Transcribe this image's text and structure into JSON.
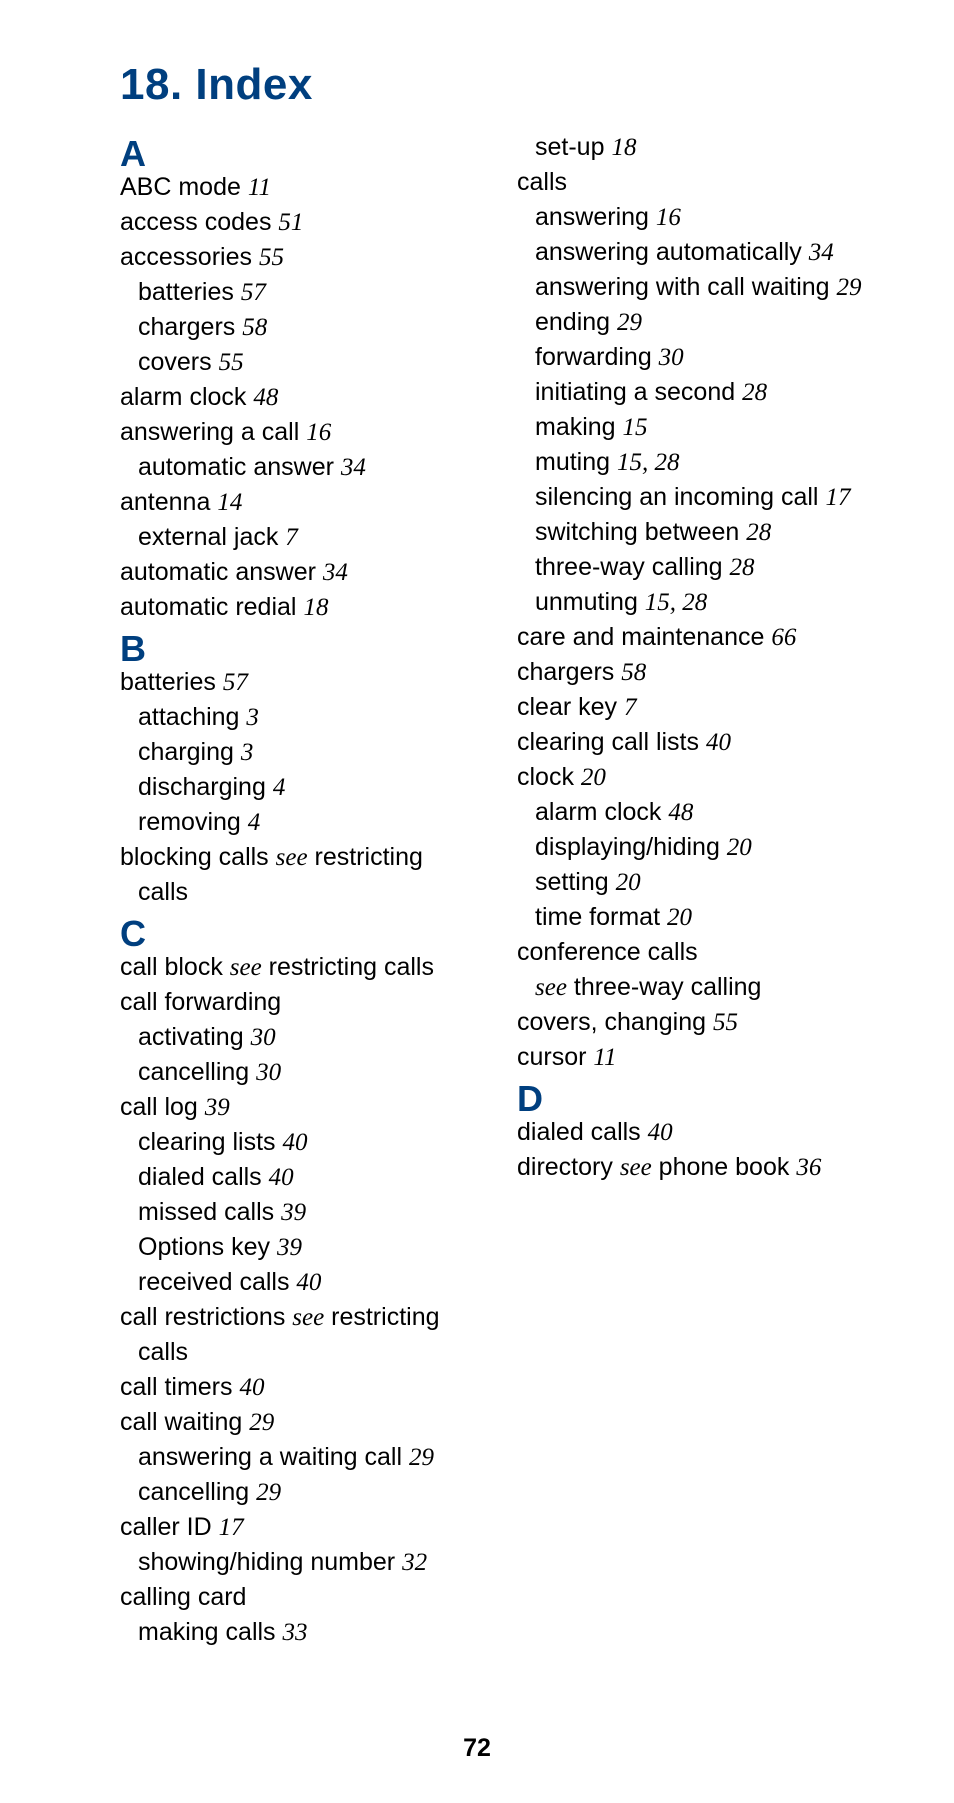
{
  "title": "18. Index",
  "pageNumber": "72",
  "sections": [
    {
      "letter": "A",
      "items": [
        {
          "text": "ABC mode",
          "page": "11"
        },
        {
          "text": "access codes",
          "page": "51"
        },
        {
          "text": "accessories",
          "page": "55"
        },
        {
          "text": "batteries",
          "page": "57",
          "sub": true
        },
        {
          "text": "chargers",
          "page": "58",
          "sub": true
        },
        {
          "text": "covers",
          "page": "55",
          "sub": true
        },
        {
          "text": "alarm clock",
          "page": "48"
        },
        {
          "text": "answering a call",
          "page": "16"
        },
        {
          "text": "automatic answer",
          "page": "34",
          "sub": true
        },
        {
          "text": "antenna",
          "page": "14"
        },
        {
          "text": "external jack",
          "page": "7",
          "sub": true
        },
        {
          "text": "automatic answer",
          "page": "34"
        },
        {
          "text": "automatic redial",
          "page": "18"
        }
      ]
    },
    {
      "letter": "B",
      "items": [
        {
          "text": "batteries",
          "page": "57"
        },
        {
          "text": "attaching",
          "page": "3",
          "sub": true
        },
        {
          "text": "charging",
          "page": "3",
          "sub": true
        },
        {
          "text": "discharging",
          "page": "4",
          "sub": true
        },
        {
          "text": "removing",
          "page": "4",
          "sub": true
        },
        {
          "text": "blocking calls ",
          "see": "see",
          "after": " restricting calls"
        }
      ]
    },
    {
      "letter": "C",
      "items": [
        {
          "text": "call block ",
          "see": "see",
          "after": " restricting calls"
        },
        {
          "text": "call forwarding"
        },
        {
          "text": "activating",
          "page": "30",
          "sub": true
        },
        {
          "text": "cancelling",
          "page": "30",
          "sub": true
        },
        {
          "text": "call log",
          "page": "39"
        },
        {
          "text": "clearing lists",
          "page": "40",
          "sub": true
        },
        {
          "text": "dialed calls",
          "page": "40",
          "sub": true
        },
        {
          "text": "missed calls",
          "page": "39",
          "sub": true
        },
        {
          "text": "Options key",
          "page": "39",
          "sub": true
        },
        {
          "text": "received calls",
          "page": "40",
          "sub": true
        },
        {
          "text": "call restrictions ",
          "see": "see",
          "after": " restricting calls"
        },
        {
          "text": "call timers",
          "page": "40"
        },
        {
          "text": "call waiting",
          "page": "29"
        },
        {
          "text": "answering a waiting call",
          "page": "29",
          "sub": true
        },
        {
          "text": "cancelling",
          "page": "29",
          "sub": true
        },
        {
          "text": "caller ID",
          "page": "17"
        },
        {
          "text": "showing/hiding number",
          "page": "32",
          "sub": true
        },
        {
          "text": "calling card"
        },
        {
          "text": "making calls",
          "page": "33",
          "sub": true
        },
        {
          "text": "set-up",
          "page": "18",
          "sub": true
        },
        {
          "text": "calls"
        },
        {
          "text": "answering",
          "page": "16",
          "sub": true
        },
        {
          "text": "answering automatically",
          "page": "34",
          "sub": true,
          "break": true
        },
        {
          "text": "answering with call waiting",
          "page": "29",
          "sub": true
        },
        {
          "text": "ending",
          "page": "29",
          "sub": true
        },
        {
          "text": "forwarding",
          "page": "30",
          "sub": true
        },
        {
          "text": "initiating a second",
          "page": "28",
          "sub": true
        },
        {
          "text": "making",
          "page": "15",
          "sub": true
        },
        {
          "text": "muting",
          "page": "15, 28",
          "sub": true
        },
        {
          "text": "silencing an incoming call",
          "page": "17",
          "sub": true
        },
        {
          "text": "switching between",
          "page": "28",
          "sub": true
        },
        {
          "text": "three-way calling",
          "page": "28",
          "sub": true
        },
        {
          "text": "unmuting",
          "page": "15, 28",
          "sub": true
        },
        {
          "text": "care and maintenance",
          "page": "66"
        },
        {
          "text": "chargers",
          "page": "58"
        },
        {
          "text": "clear key",
          "page": "7"
        },
        {
          "text": "clearing call lists",
          "page": "40"
        },
        {
          "text": "clock",
          "page": "20"
        },
        {
          "text": "alarm clock",
          "page": "48",
          "sub": true
        },
        {
          "text": "displaying/hiding",
          "page": "20",
          "sub": true
        },
        {
          "text": "setting",
          "page": "20",
          "sub": true
        },
        {
          "text": "time format",
          "page": "20",
          "sub": true
        },
        {
          "text": "conference calls"
        },
        {
          "see": "see",
          "after": " three-way calling",
          "sub": true,
          "text": ""
        },
        {
          "text": "covers, changing",
          "page": "55"
        },
        {
          "text": "cursor",
          "page": "11"
        }
      ]
    },
    {
      "letter": "D",
      "items": [
        {
          "text": "dialed calls",
          "page": "40"
        },
        {
          "text": "directory ",
          "see": "see",
          "after": " phone book",
          "page": "36"
        }
      ]
    }
  ]
}
